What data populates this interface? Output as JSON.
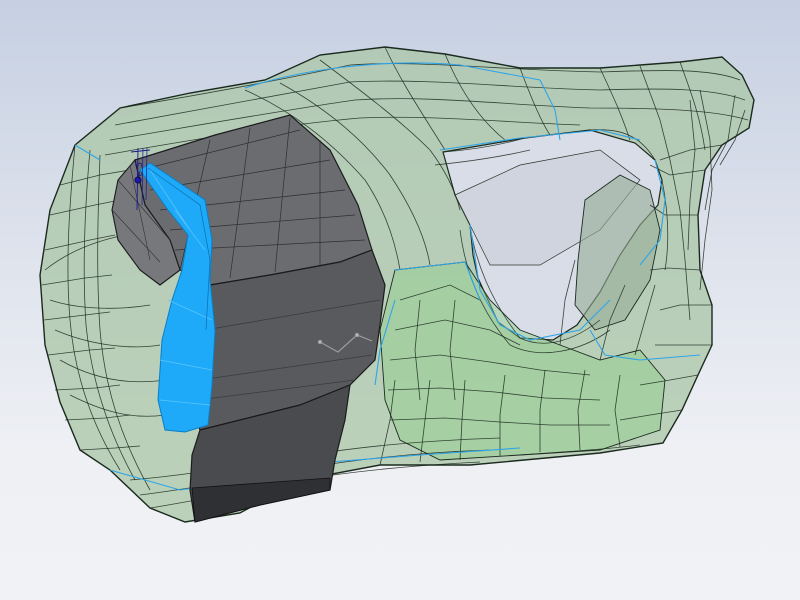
{
  "viewport": {
    "background_top": "#c6d0e2",
    "background_bottom": "#f1f2f5"
  },
  "model": {
    "shell_fill": "#a9c6a6",
    "shell_edge": "#1b2a1e",
    "boundary_edge": "#2fa4e8",
    "core_fill": "#5e5f63",
    "core_dark": "#2f3033",
    "selected_face": "#1eaaf8",
    "inner_green": "#8fcf8a"
  },
  "annotations": {
    "dimension_text": "5",
    "dimension_text_2": "e"
  },
  "icons": {
    "origin": "origin-point-icon",
    "dimension": "dimension-marker-icon"
  }
}
